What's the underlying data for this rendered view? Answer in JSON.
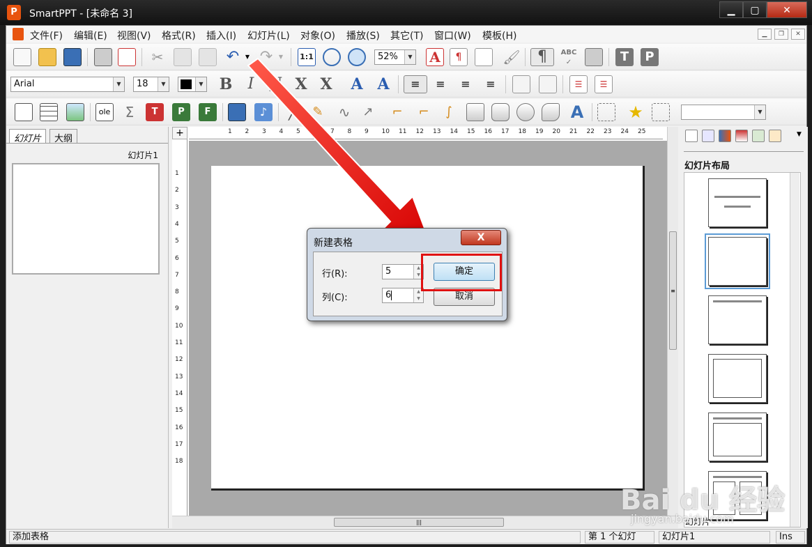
{
  "window": {
    "app_name": "SmartPPT",
    "title": "SmartPPT    - [未命名 3]",
    "icon_letter": "P"
  },
  "menu": [
    "文件(F)",
    "编辑(E)",
    "视图(V)",
    "格式(R)",
    "插入(I)",
    "幻灯片(L)",
    "对象(O)",
    "播放(S)",
    "其它(T)",
    "窗口(W)",
    "模板(H)"
  ],
  "toolbar": {
    "zoom": "52%",
    "fit_label": "1:1"
  },
  "format_bar": {
    "font": "Arial",
    "size": "18",
    "letters": [
      "B",
      "I",
      "U",
      "X",
      "X"
    ]
  },
  "left_pane": {
    "tabs": [
      "幻灯片",
      "大纲"
    ],
    "slide_label": "幻灯片1"
  },
  "ruler": {
    "h_ticks": [
      "1",
      "2",
      "3",
      "4",
      "5",
      "6",
      "7",
      "8",
      "9",
      "10",
      "11",
      "12",
      "13",
      "14",
      "15",
      "16",
      "17",
      "18",
      "19",
      "20",
      "21",
      "22",
      "23",
      "24",
      "25"
    ],
    "v_ticks": [
      "1",
      "2",
      "3",
      "4",
      "5",
      "6",
      "7",
      "8",
      "9",
      "10",
      "11",
      "12",
      "13",
      "14",
      "15",
      "16",
      "17",
      "18"
    ]
  },
  "right_pane": {
    "title": "幻灯片布局",
    "bottom_label": "幻灯片"
  },
  "dialog": {
    "title": "新建表格",
    "close_label": "X",
    "rows_label": "行(R):",
    "rows_value": "5",
    "cols_label": "列(C):",
    "cols_value": "6",
    "ok_label": "确定",
    "cancel_label": "取消"
  },
  "status": {
    "message": "添加表格",
    "slide_pos": "第 1 个幻灯",
    "slide_name": "幻灯片1",
    "mode": "Ins"
  },
  "watermark": {
    "text": "Bai du 经验",
    "sub": "jingyan.baidu.com"
  },
  "colors": {
    "highlight": "#e01010",
    "arrow": "#e01010",
    "accent": "#e8540f"
  }
}
